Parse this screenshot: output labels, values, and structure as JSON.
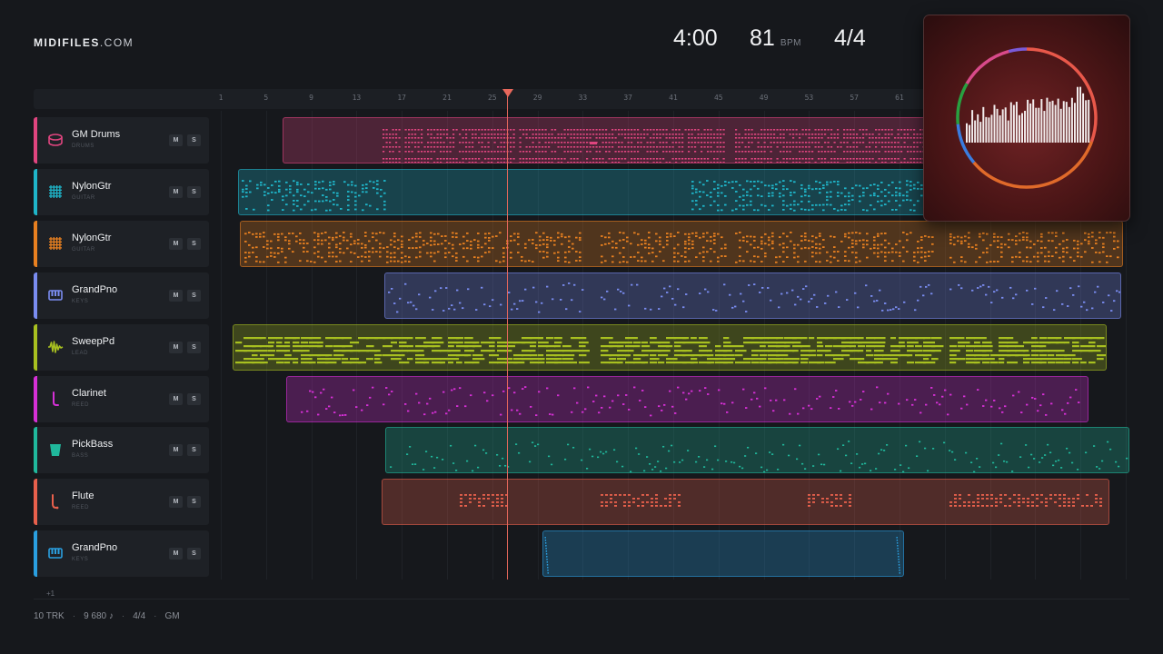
{
  "brand": {
    "name": "MIDIFILES",
    "suffix": ".COM"
  },
  "stats": {
    "duration": "4:00",
    "tempo": "81",
    "tempo_unit": "BPM",
    "meter": "4/4"
  },
  "ruler": {
    "ticks": [
      "1",
      "5",
      "9",
      "13",
      "17",
      "21",
      "25",
      "29",
      "33",
      "37",
      "41",
      "45",
      "49",
      "53",
      "57",
      "61"
    ]
  },
  "tracks": [
    {
      "name": "GM Drums",
      "category": "DRUMS",
      "color": "#e0457f",
      "icon": "drum-icon",
      "mute": "M",
      "solo": "S"
    },
    {
      "name": "NylonGtr",
      "category": "GUITAR",
      "color": "#1fb5c9",
      "icon": "guitar-grid-icon",
      "mute": "M",
      "solo": "S"
    },
    {
      "name": "NylonGtr",
      "category": "GUITAR",
      "color": "#e88020",
      "icon": "guitar-grid-icon",
      "mute": "M",
      "solo": "S"
    },
    {
      "name": "GrandPno",
      "category": "KEYS",
      "color": "#7a8cf0",
      "icon": "piano-keys-icon",
      "mute": "M",
      "solo": "S"
    },
    {
      "name": "SweepPd",
      "category": "LEAD",
      "color": "#a8c020",
      "icon": "waveform-icon",
      "mute": "M",
      "solo": "S"
    },
    {
      "name": "Clarinet",
      "category": "REED",
      "color": "#d630d6",
      "icon": "clarinet-icon",
      "mute": "M",
      "solo": "S"
    },
    {
      "name": "PickBass",
      "category": "BASS",
      "color": "#20b89c",
      "icon": "bass-amp-icon",
      "mute": "M",
      "solo": "S"
    },
    {
      "name": "Flute",
      "category": "REED",
      "color": "#e8604c",
      "icon": "flute-icon",
      "mute": "M",
      "solo": "S"
    },
    {
      "name": "GrandPno",
      "category": "KEYS",
      "color": "#2a9fe0",
      "icon": "piano-keys-icon",
      "mute": "M",
      "solo": "S"
    }
  ],
  "more_tracks": "+1",
  "footer": {
    "tracks": "10 TRK",
    "notes": "9 680 ♪",
    "meter": "4/4",
    "standard": "GM"
  },
  "visualizer": {
    "ring_colors": [
      "#e8584a",
      "#e06a2a",
      "#3a7de0",
      "#28a040",
      "#d84a8a",
      "#7a5ad8"
    ]
  }
}
